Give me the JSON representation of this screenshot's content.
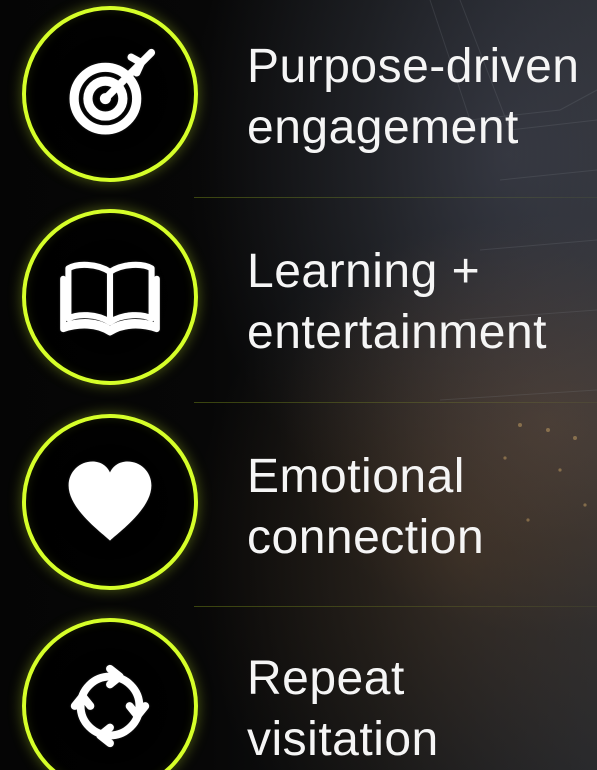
{
  "accent_color": "#d6ff29",
  "items": [
    {
      "icon": "target-icon",
      "line1": "Purpose-driven",
      "line2": "engagement"
    },
    {
      "icon": "open-book-icon",
      "line1": "Learning +",
      "line2": "entertainment"
    },
    {
      "icon": "heart-icon",
      "line1": "Emotional",
      "line2": "connection"
    },
    {
      "icon": "repeat-cycle-icon",
      "line1": "Repeat",
      "line2": "visitation"
    }
  ]
}
